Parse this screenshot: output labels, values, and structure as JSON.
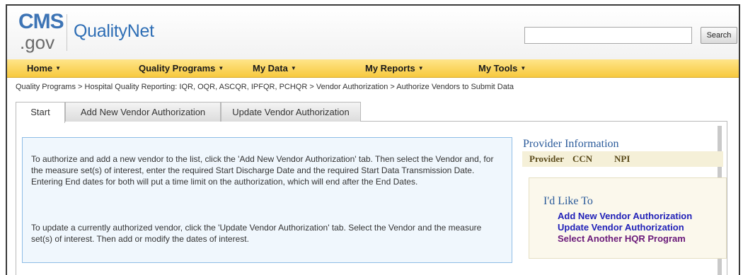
{
  "header": {
    "logo_top": "CMS",
    "logo_bottom": ".gov",
    "brand": "QualityNet",
    "search_value": "",
    "search_button": "Search"
  },
  "nav": {
    "items": [
      {
        "label": "Home"
      },
      {
        "label": "Quality Programs"
      },
      {
        "label": "My Data"
      },
      {
        "label": "My Reports"
      },
      {
        "label": "My Tools"
      }
    ],
    "caret": "▼"
  },
  "breadcrumb": "Quality Programs > Hospital Quality Reporting: IQR, OQR, ASCQR, IPFQR, PCHQR > Vendor Authorization > Authorize Vendors to Submit Data",
  "tabs": [
    {
      "label": "Start",
      "active": true
    },
    {
      "label": "Add New Vendor Authorization"
    },
    {
      "label": "Update Vendor Authorization"
    }
  ],
  "instructions": {
    "paragraph1": "To authorize and add a new vendor to the list, click the 'Add New Vendor Authorization' tab. Then select the Vendor and, for the measure set(s) of interest, enter the required Start Discharge Date and the required Start Data Transmission Date. Entering End dates for both will put a time limit on the authorization, which will end after the End Dates.",
    "paragraph2": "To update a currently authorized vendor, click the 'Update Vendor Authorization' tab. Select the Vendor and the measure set(s) of interest. Then add or modify the dates of interest."
  },
  "provider_info": {
    "title": "Provider Information",
    "provider_label": "Provider",
    "ccn_label": "CCN",
    "npi_label": "NPI"
  },
  "id_like_to": {
    "title": "I'd Like To",
    "links": [
      {
        "label": "Add New Vendor Authorization"
      },
      {
        "label": "Update Vendor Authorization"
      },
      {
        "label": "Select Another HQR Program"
      }
    ]
  },
  "colors": {
    "nav_bar": "#f7c93e",
    "brand_blue": "#2e6eb5",
    "link_blue": "#2121b8",
    "link_purple": "#6a1a7a",
    "info_bg": "#f0f7fd"
  }
}
